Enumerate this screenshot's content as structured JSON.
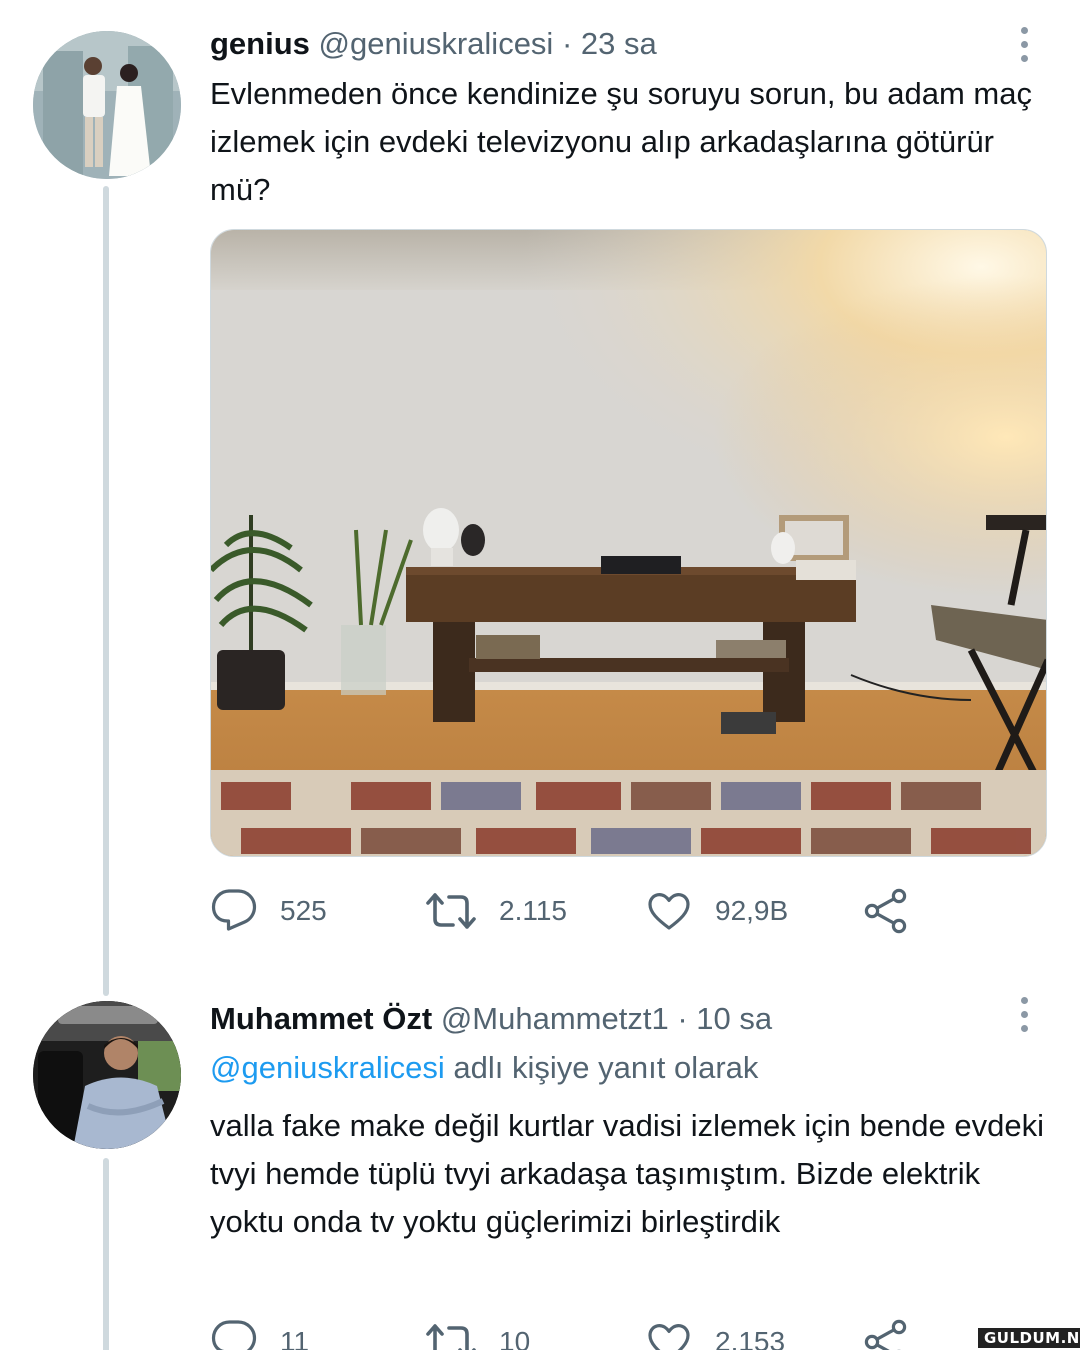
{
  "tweets": [
    {
      "name": "genius",
      "handle": "@geniuskralicesi",
      "time": "· 23 sa",
      "text": "Evlenmeden önce kendinize şu soruyu sorun, bu adam maç izlemek için evdeki televizyonu alıp arkadaşlarına götürür mü?",
      "stats": {
        "replies": "525",
        "retweets": "2.115",
        "likes": "92,9B"
      }
    },
    {
      "name": "Muhammet Özt",
      "handle": "@Muhammetzt1",
      "time": "· 10 sa",
      "reply_mention": "@geniuskralicesi",
      "reply_suffix": " adlı kişiye yanıt olarak",
      "text": "valla fake make değil kurtlar vadisi izlemek için bende evdeki tvyi hemde tüplü tvyi arkadaşa taşımıştım. Bizde elektrik yoktu onda tv yoktu güçlerimizi birleştirdik",
      "stats": {
        "replies": "11",
        "retweets": "10",
        "likes": "2.153"
      }
    }
  ],
  "watermark": "GULDUM.NET",
  "icons": {
    "reply": "reply-icon",
    "retweet": "retweet-icon",
    "like": "heart-icon",
    "share": "share-icon",
    "more": "more-icon"
  },
  "colors": {
    "text": "#0f1419",
    "secondary": "#536471",
    "link": "#1d9bf0",
    "thread_line": "#cfd9de"
  }
}
